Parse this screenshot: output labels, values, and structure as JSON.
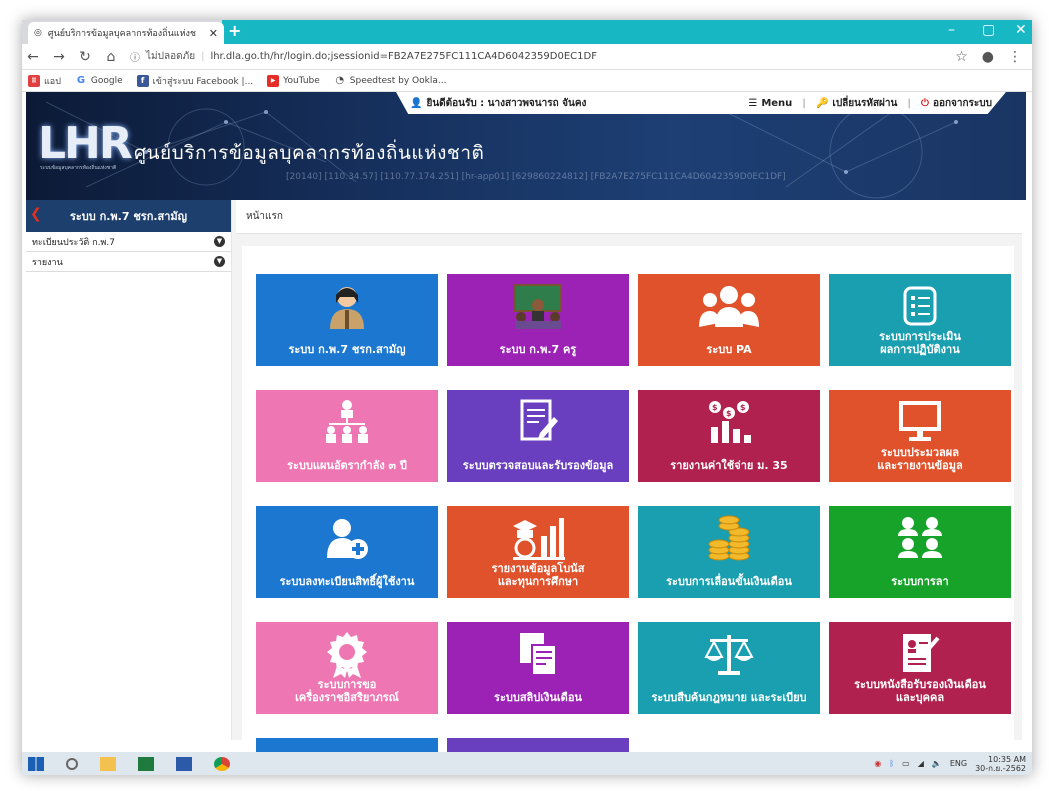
{
  "browser": {
    "tab_title": "ศูนย์บริการข้อมูลบุคลากรท้องถิ่นแห่งช",
    "not_secure": "ไม่ปลอดภัย",
    "url": "lhr.dla.go.th/hr/login.do;jsessionid=FB2A7E275FC111CA4D6042359D0EC1DF",
    "bookmarks": [
      {
        "label": "แอป",
        "icon": "apps-icon",
        "color": "#e04040"
      },
      {
        "label": "Google",
        "icon": "google-icon",
        "color": "#4285f4"
      },
      {
        "label": "เข้าสู่ระบบ Facebook |...",
        "icon": "facebook-icon",
        "color": "#3b5998"
      },
      {
        "label": "YouTube",
        "icon": "youtube-icon",
        "color": "#e52d27"
      },
      {
        "label": "Speedtest by Ookla...",
        "icon": "speedtest-icon",
        "color": "#555555"
      }
    ]
  },
  "header": {
    "welcome": "ยินดีต้อนรับ : นางสาวพจนารถ จันคง",
    "menu": "Menu",
    "change_password": "เปลี่ยนรหัสผ่าน",
    "logout": "ออกจากระบบ",
    "logo": "LHR",
    "logo_sub": "ระบบข้อมูลบุคลากรท้องถิ่นแห่งชาติ",
    "site_title": "ศูนย์บริการข้อมูลบุคลากรท้องถิ่นแห่งชาติ",
    "session_line": "[20140] [110.34.57] [110.77.174.251] [hr-app01] [629860224812] [FB2A7E275FC111CA4D6042359D0EC1DF]"
  },
  "sidebar": {
    "title": "ระบบ ก.พ.7 ชรก.สามัญ",
    "items": [
      {
        "label": "ทะเบียนประวัติ ก.พ.7"
      },
      {
        "label": "รายงาน"
      }
    ]
  },
  "main": {
    "breadcrumb": "หน้าแรก",
    "tiles": [
      {
        "label": "ระบบ ก.พ.7 ชรก.สามัญ",
        "color": "#1b77cf",
        "icon": "officer-icon"
      },
      {
        "label": "ระบบ ก.พ.7 ครู",
        "color": "#9b22b5",
        "icon": "teacher-icon"
      },
      {
        "label": "ระบบ PA",
        "color": "#e0522c",
        "icon": "group-icon"
      },
      {
        "label": "ระบบการประเมิน\nผลการปฏิบัติงาน",
        "color": "#1a9fb0",
        "icon": "checklist-icon"
      },
      {
        "label": "ระบบแผนอัตรากำลัง ๓ ปี",
        "color": "#ee77b3",
        "icon": "org-chart-icon"
      },
      {
        "label": "ระบบตรวจสอบและรับรองข้อมูล",
        "color": "#6a3fbf",
        "icon": "document-edit-icon"
      },
      {
        "label": "รายงานค่าใช้จ่าย ม. 35",
        "color": "#b0214f",
        "icon": "money-chart-icon"
      },
      {
        "label": "ระบบประมวลผล\nและรายงานข้อมูล",
        "color": "#e0522c",
        "icon": "monitor-icon"
      },
      {
        "label": "ระบบลงทะเบียนสิทธิ์ผู้ใช้งาน",
        "color": "#1b77cf",
        "icon": "add-user-icon"
      },
      {
        "label": "รายงานข้อมูลโบนัส\nและทุนการศึกษา",
        "color": "#e0522c",
        "icon": "graduation-chart-icon"
      },
      {
        "label": "ระบบการเลื่อนขั้นเงินเดือน",
        "color": "#1a9fb0",
        "icon": "coins-icon"
      },
      {
        "label": "ระบบการลา",
        "color": "#17a32a",
        "icon": "users-icon"
      },
      {
        "label": "ระบบการขอ\nเครื่องราชอิสริยาภรณ์",
        "color": "#ee77b3",
        "icon": "medal-icon"
      },
      {
        "label": "ระบบสลิปเงินเดือน",
        "color": "#9b22b5",
        "icon": "documents-icon"
      },
      {
        "label": "ระบบสืบค้นกฎหมาย และระเบียบ",
        "color": "#1a9fb0",
        "icon": "scales-icon"
      },
      {
        "label": "ระบบหนังสือรับรองเงินเดือน\nและบุคคล",
        "color": "#b0214f",
        "icon": "certificate-icon"
      },
      {
        "label": "",
        "color": "#1b77cf",
        "icon": ""
      },
      {
        "label": "",
        "color": "#6a3fbf",
        "icon": ""
      }
    ]
  },
  "taskbar": {
    "lang": "ENG",
    "time": "10:35 AM",
    "date": "30-ก.ย.-2562"
  }
}
